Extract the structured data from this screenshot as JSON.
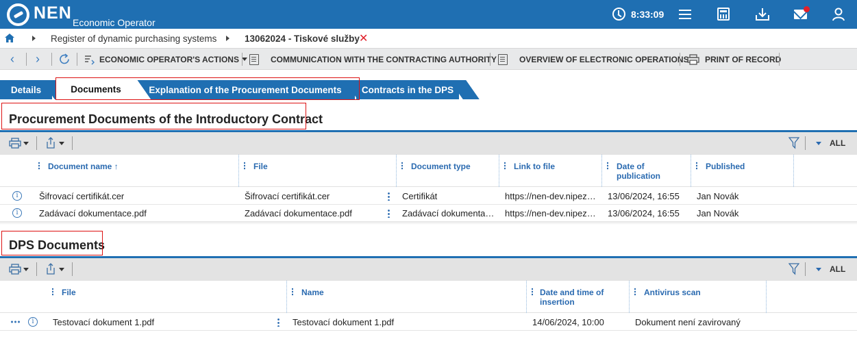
{
  "header": {
    "brand": "NEN",
    "subtitle": "Economic Operator",
    "time": "8:33:09",
    "icons": [
      "clock-icon",
      "menu-icon",
      "calculator-icon",
      "inbox-download-icon",
      "mail-icon",
      "user-icon"
    ]
  },
  "breadcrumb": {
    "items": [
      "Register of dynamic purchasing systems",
      "13062024 - Tiskové služby"
    ]
  },
  "toolbar": {
    "actions_label": "ECONOMIC OPERATOR'S ACTIONS",
    "communication_label": "COMMUNICATION WITH THE CONTRACTING AUTHORITY",
    "overview_label": "OVERVIEW OF ELECTRONIC OPERATIONS",
    "print_label": "PRINT OF RECORD"
  },
  "tabs": [
    {
      "label": "Details"
    },
    {
      "label": "Documents"
    },
    {
      "label": "Explanation of the Procurement Documents"
    },
    {
      "label": "Contracts in the DPS"
    }
  ],
  "section1": {
    "title": "Procurement Documents of the Introductory Contract",
    "filter_all": "ALL",
    "columns": [
      "Document name",
      "File",
      "Document type",
      "Link to file",
      "Date of publication",
      "Published"
    ],
    "rows": [
      {
        "name": "Šifrovací certifikát.cer",
        "file": "Šifrovací certifikát.cer",
        "type": "Certifikát",
        "link": "https://nen-dev.nipez…",
        "date": "13/06/2024, 16:55",
        "published": "Jan Novák"
      },
      {
        "name": "Zadávací dokumentace.pdf",
        "file": "Zadávací dokumentace.pdf",
        "type": "Zadávací dokumenta…",
        "link": "https://nen-dev.nipez…",
        "date": "13/06/2024, 16:55",
        "published": "Jan Novák"
      }
    ]
  },
  "section2": {
    "title": "DPS Documents",
    "filter_all": "ALL",
    "columns": [
      "File",
      "Name",
      "Date and time of insertion",
      "Antivirus scan"
    ],
    "rows": [
      {
        "file": "Testovací dokument 1.pdf",
        "name": "Testovací dokument 1.pdf",
        "date": "14/06/2024, 10:00",
        "scan": "Dokument není zavirovaný"
      }
    ]
  },
  "colors": {
    "brand_blue": "#1f6fb2",
    "alert_red": "#e0202a",
    "header_text": "#2a6ab0"
  }
}
